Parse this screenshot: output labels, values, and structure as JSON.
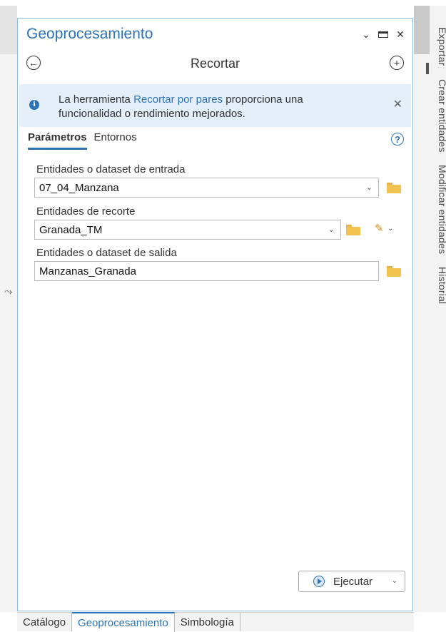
{
  "pane": {
    "title": "Geoprocesamiento",
    "controls": {
      "dropdown": "⌄",
      "maximize": "",
      "close": "✕"
    }
  },
  "tool": {
    "title": "Recortar",
    "back_icon": "arrow-left-circle-icon",
    "add_icon": "plus-circle-icon"
  },
  "info_bar": {
    "text_before": "La herramienta ",
    "link": "Recortar por pares",
    "text_after": " proporciona una funcionalidad o rendimiento mejorados.",
    "close": "✕"
  },
  "tabs": [
    {
      "label": "Parámetros",
      "active": true
    },
    {
      "label": "Entornos",
      "active": false
    }
  ],
  "help": "?",
  "params": [
    {
      "label": "Entidades o dataset de entrada",
      "value": "07_04_Manzana"
    },
    {
      "label": "Entidades de recorte",
      "value": "Granada_TM"
    },
    {
      "label": "Entidades o dataset de salida",
      "value": "Manzanas_Granada"
    }
  ],
  "run_button": {
    "label": "Ejecutar"
  },
  "bottom_tabs": [
    "Catálogo",
    "Geoprocesamiento",
    "Simbología"
  ],
  "side_tabs": [
    "Exportar",
    "Crear entidades",
    "Modificar entidades",
    "Historial"
  ],
  "colors": {
    "accent": "#2a73b8",
    "info_bg": "#e3eef9",
    "folder": "#f2c24e"
  }
}
